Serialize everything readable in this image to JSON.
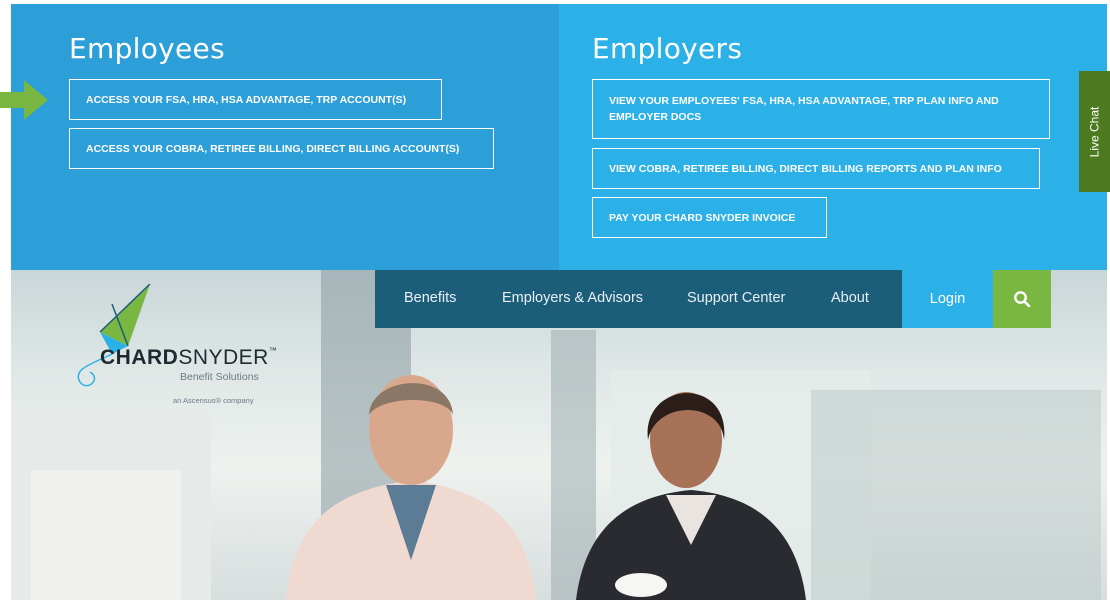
{
  "employees": {
    "title": "Employees",
    "buttons": [
      "ACCESS YOUR FSA, HRA, HSA ADVANTAGE, TRP ACCOUNT(S)",
      "ACCESS YOUR COBRA, RETIREE BILLING, DIRECT BILLING ACCOUNT(S)"
    ]
  },
  "employers": {
    "title": "Employers",
    "buttons": [
      "VIEW YOUR EMPLOYEES' FSA, HRA, HSA ADVANTAGE, TRP PLAN INFO AND EMPLOYER DOCS",
      "VIEW COBRA, RETIREE BILLING, DIRECT BILLING REPORTS AND PLAN INFO",
      "PAY YOUR CHARD SNYDER INVOICE"
    ]
  },
  "live_chat": "Live Chat",
  "nav": {
    "items": [
      "Benefits",
      "Employers & Advisors",
      "Support Center",
      "About"
    ],
    "login": "Login"
  },
  "logo": {
    "word_bold": "CHARD",
    "word_light": "SNYDER",
    "tm": "™",
    "subtitle": "Benefit Solutions",
    "company": "an Ascensus® company"
  },
  "icons": {
    "arrow": "right-arrow-icon",
    "search": "search-icon",
    "kite": "kite-logo-icon"
  },
  "colors": {
    "employees_bg": "#2d9fd8",
    "employers_bg": "#2bb1e8",
    "nav_bg": "#1c5d7a",
    "accent_green": "#7ab642",
    "live_chat_bg": "#4e7a1f"
  }
}
